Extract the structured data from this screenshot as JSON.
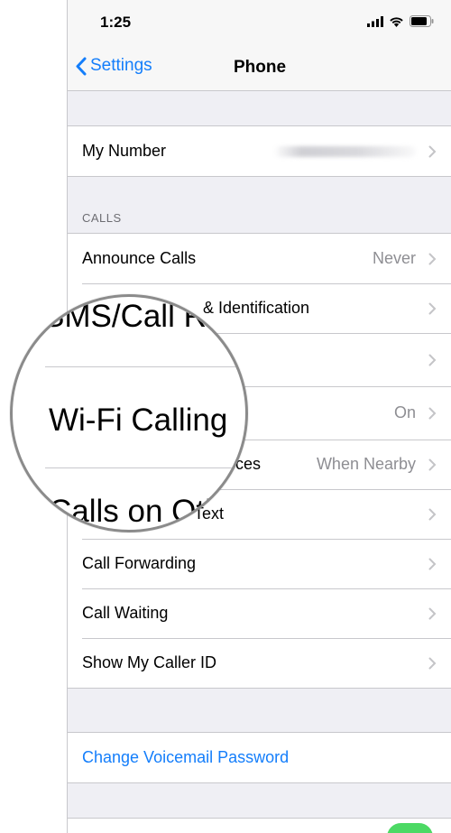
{
  "status_bar": {
    "time": "1:25"
  },
  "nav": {
    "back_label": "Settings",
    "title": "Phone"
  },
  "my_number": {
    "label": "My Number"
  },
  "calls_section": {
    "header": "CALLS",
    "rows": [
      {
        "label": "Announce Calls",
        "value": "Never"
      },
      {
        "label": "SMS/Call Reporting & Identification",
        "visible_fragment": "& Identification",
        "value": ""
      },
      {
        "label": "Wi-Fi Calling",
        "value": "On"
      },
      {
        "label": "Calls on Other Devices",
        "visible_fragment": "ces",
        "value": "When Nearby"
      },
      {
        "label": "Respond with Text",
        "visible_fragment": "Text",
        "value": ""
      },
      {
        "label": "Call Forwarding",
        "value": ""
      },
      {
        "label": "Call Waiting",
        "value": ""
      },
      {
        "label": "Show My Caller ID",
        "value": ""
      }
    ]
  },
  "voicemail": {
    "label": "Change Voicemail Password"
  },
  "magnifier": {
    "lines": [
      "SMS/Call Re",
      "Wi-Fi Calling",
      "Calls on Oth"
    ]
  },
  "colors": {
    "accent": "#147efb",
    "background": "#efeff4",
    "separator": "#c8c8cc",
    "toggle_on": "#4cd964"
  }
}
